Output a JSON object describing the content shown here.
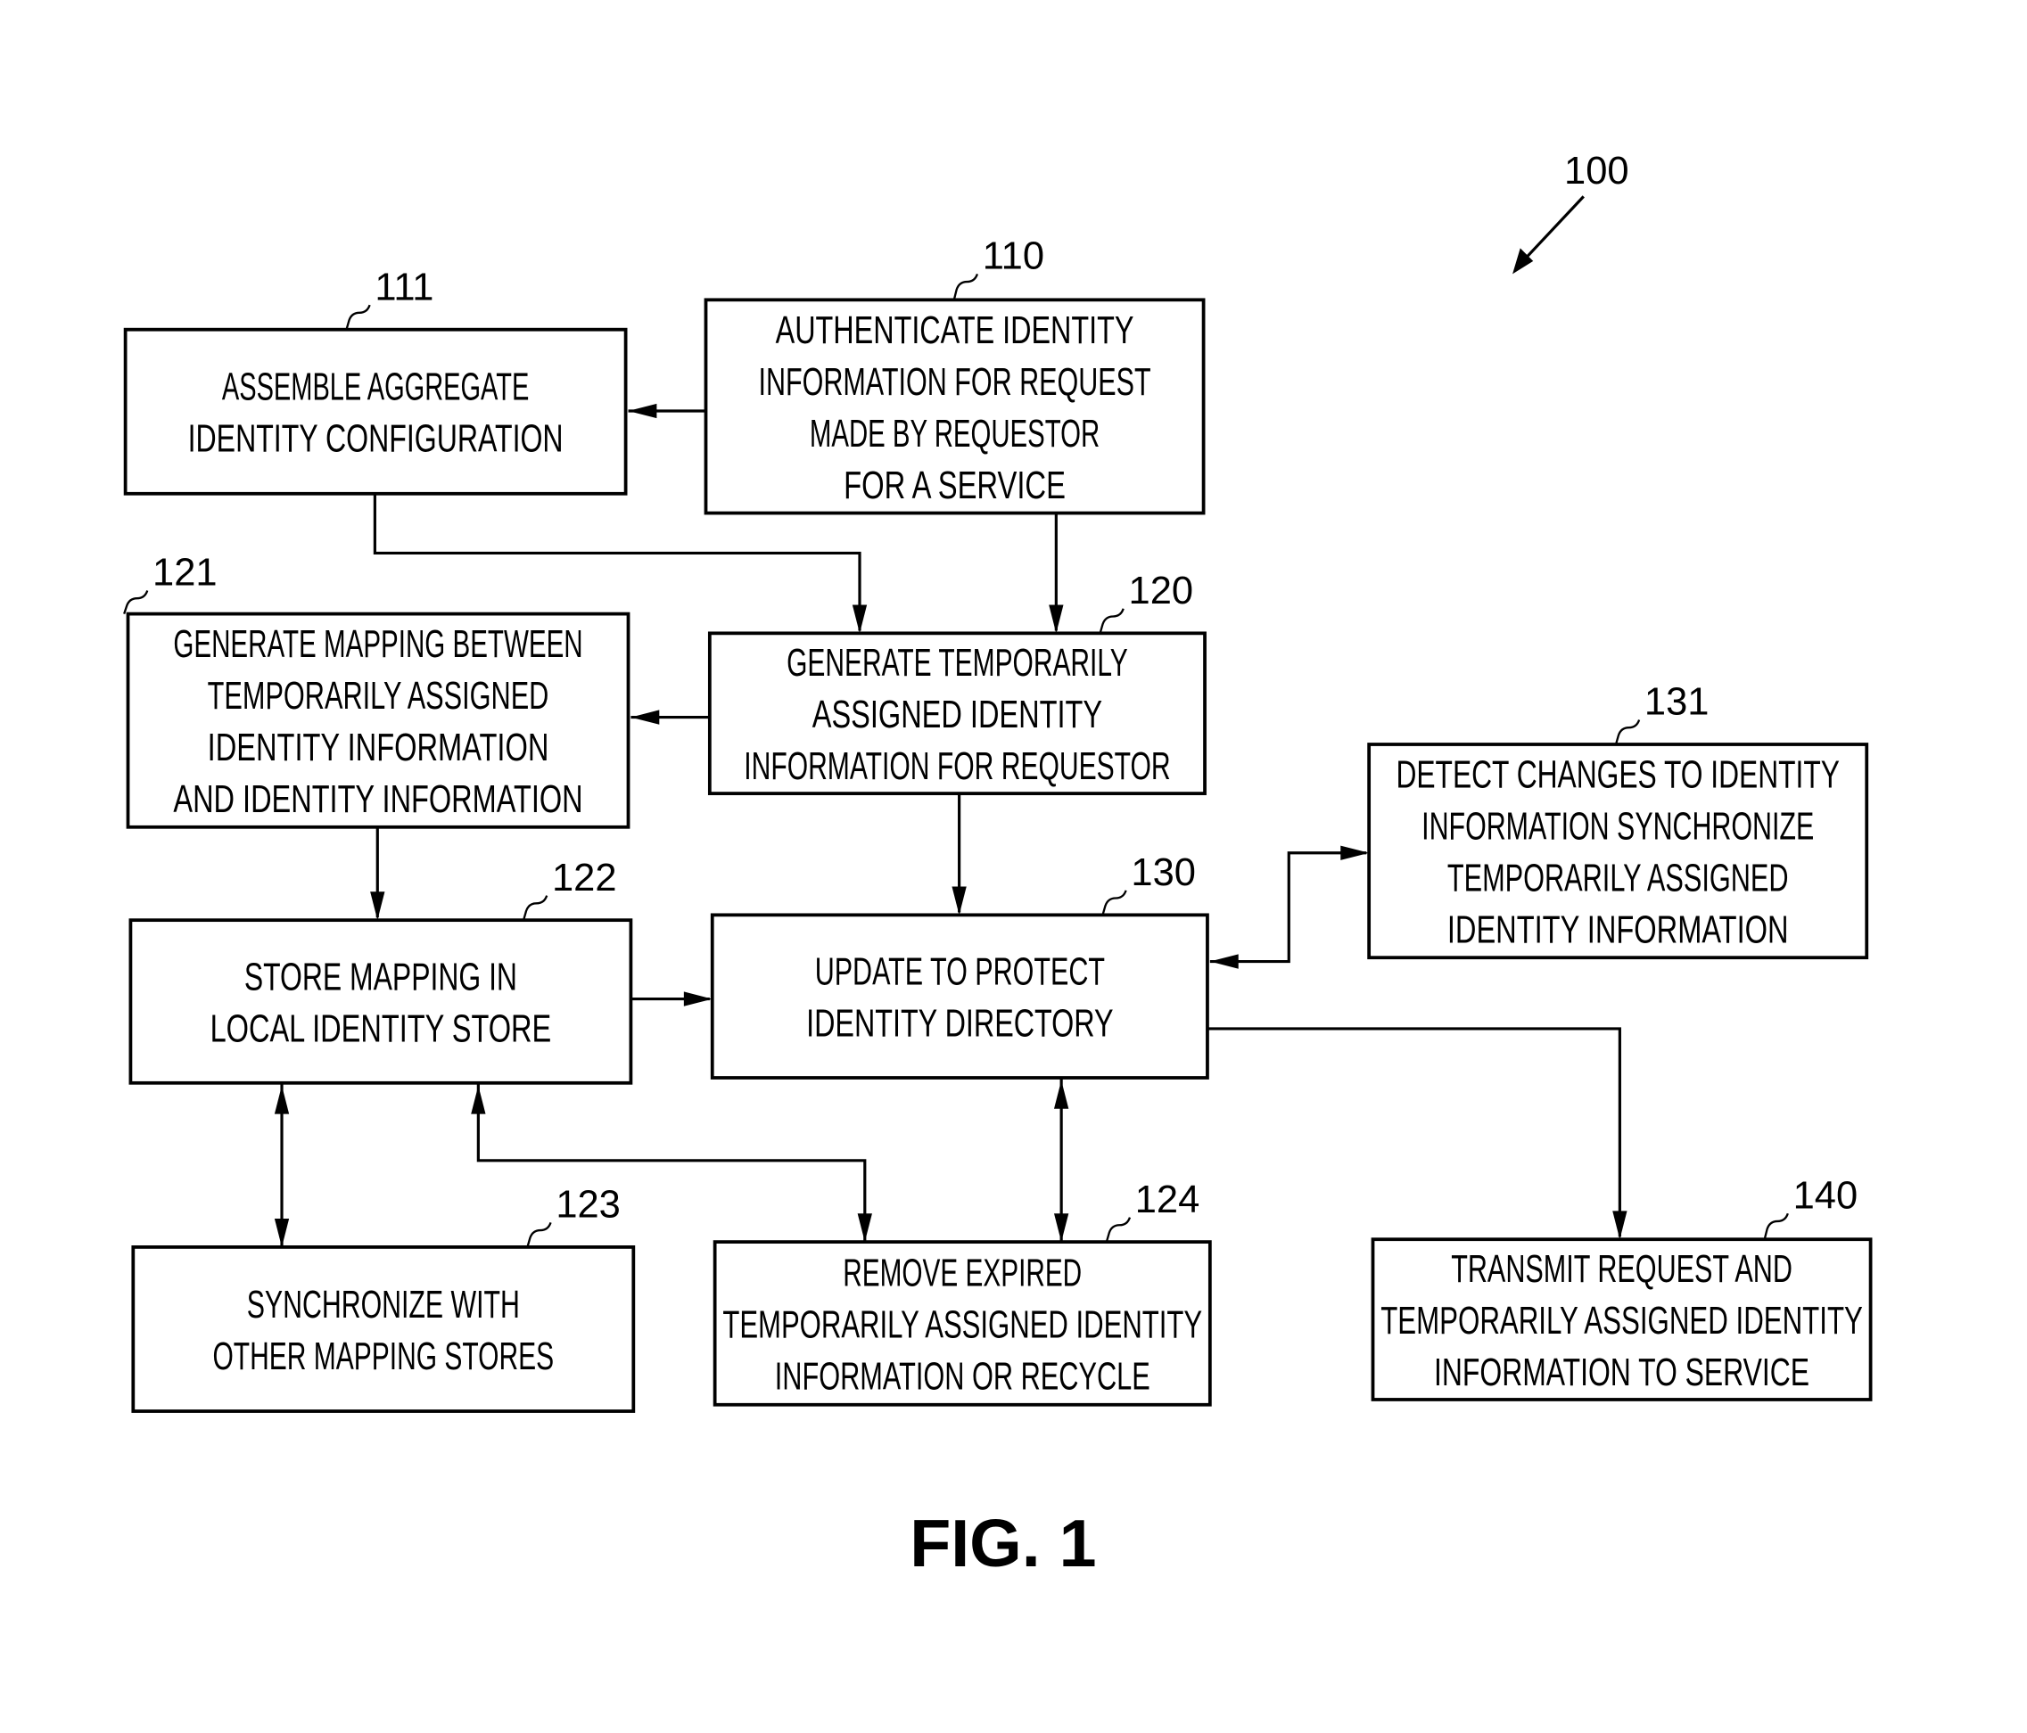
{
  "figure": {
    "label": "FIG. 1",
    "ref": "100"
  },
  "boxes": [
    {
      "id": "111",
      "lines": [
        "ASSEMBLE AGGREGATE",
        "IDENTITY CONFIGURATION"
      ]
    },
    {
      "id": "110",
      "lines": [
        "AUTHENTICATE IDENTITY",
        "INFORMATION FOR REQUEST",
        "MADE BY REQUESTOR",
        "FOR A SERVICE"
      ]
    },
    {
      "id": "121",
      "lines": [
        "GENERATE MAPPING BETWEEN",
        "TEMPORARILY ASSIGNED",
        "IDENTITY INFORMATION",
        "AND IDENTITY INFORMATION"
      ]
    },
    {
      "id": "120",
      "lines": [
        "GENERATE TEMPORARILY",
        "ASSIGNED IDENTITY",
        "INFORMATION FOR REQUESTOR"
      ]
    },
    {
      "id": "131",
      "lines": [
        "DETECT CHANGES TO IDENTITY",
        "INFORMATION SYNCHRONIZE",
        "TEMPORARILY ASSIGNED",
        "IDENTITY INFORMATION"
      ]
    },
    {
      "id": "122",
      "lines": [
        "STORE MAPPING IN",
        "LOCAL IDENTITY STORE"
      ]
    },
    {
      "id": "130",
      "lines": [
        "UPDATE TO PROTECT",
        "IDENTITY DIRECTORY"
      ]
    },
    {
      "id": "123",
      "lines": [
        "SYNCHRONIZE WITH",
        "OTHER MAPPING STORES"
      ]
    },
    {
      "id": "124",
      "lines": [
        "REMOVE EXPIRED",
        "TEMPORARILY ASSIGNED IDENTITY",
        "INFORMATION OR RECYCLE"
      ]
    },
    {
      "id": "140",
      "lines": [
        "TRANSMIT REQUEST AND",
        "TEMPORARILY ASSIGNED IDENTITY",
        "INFORMATION TO SERVICE"
      ]
    }
  ]
}
